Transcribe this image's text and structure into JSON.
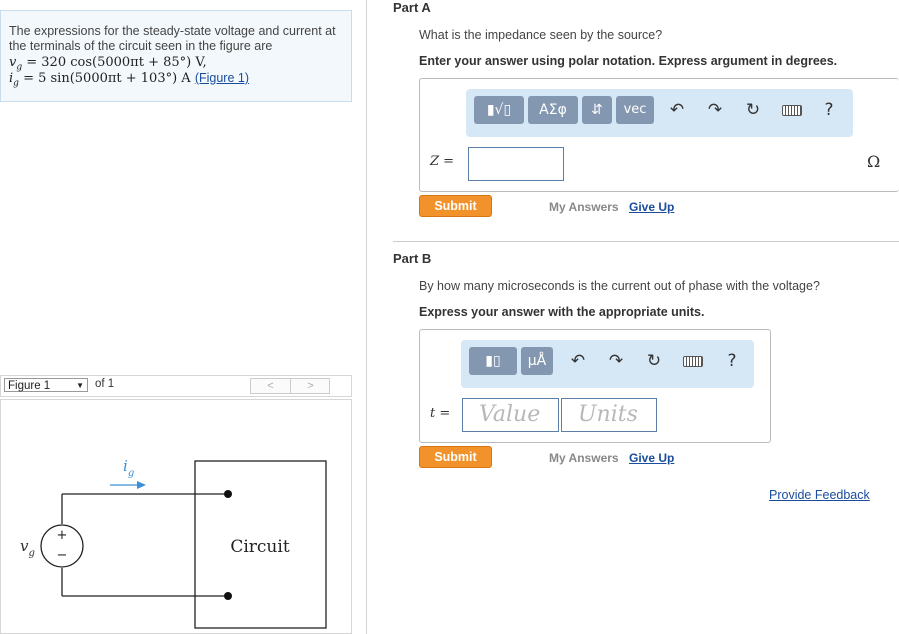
{
  "problem": {
    "intro": "The expressions for the steady-state voltage and current at the terminals of the circuit seen in the figure are",
    "vg_lhs": "v",
    "vg_sub": "g",
    "vg_rhs": " = 320 cos(5000πt + 85°) V,",
    "ig_lhs": "i",
    "ig_sub": "g",
    "ig_rhs": " = 5 sin(5000πt + 103°) A",
    "figure_link": "(Figure 1)"
  },
  "figure_nav": {
    "select_value": "Figure 1",
    "of_label": "of 1",
    "prev": "<",
    "next": ">"
  },
  "figure": {
    "source_label": "v",
    "source_sub": "g",
    "current_label": "i",
    "current_sub": "g",
    "plus": "+",
    "minus": "−",
    "circuit_label": "Circuit"
  },
  "partA": {
    "title": "Part A",
    "question": "What is the impedance seen by the source?",
    "instruction": "Enter your answer using polar notation. Express argument in degrees.",
    "toolbar": {
      "template": "▮√▯",
      "greek": "ΑΣφ",
      "sort": "⇵",
      "vec": "vec",
      "undo": "↶",
      "redo": "↷",
      "reset": "↻",
      "help": "?"
    },
    "var_label": "Z =",
    "unit": "Ω",
    "submit": "Submit",
    "my_answers": "My Answers",
    "give_up": "Give Up"
  },
  "partB": {
    "title": "Part B",
    "question": "By how many microseconds is the current out of phase with the voltage?",
    "instruction": "Express your answer with the appropriate units.",
    "toolbar": {
      "template": "▮▯",
      "units": "μÅ",
      "undo": "↶",
      "redo": "↷",
      "reset": "↻",
      "help": "?"
    },
    "var_label": "t =",
    "value_placeholder": "Value",
    "units_placeholder": "Units",
    "submit": "Submit",
    "my_answers": "My Answers",
    "give_up": "Give Up"
  },
  "feedback": "Provide Feedback"
}
